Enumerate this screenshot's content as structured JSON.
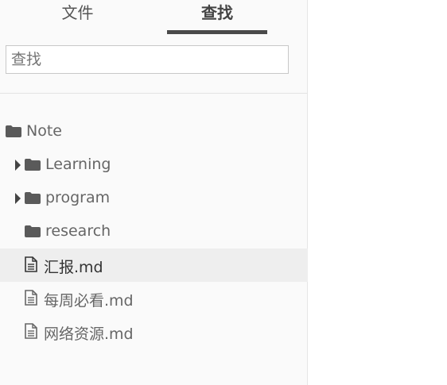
{
  "tabs": {
    "files_label": "文件",
    "search_label": "查找"
  },
  "search": {
    "placeholder": "查找",
    "value": ""
  },
  "tree": {
    "root": "Note",
    "folders": [
      "Learning",
      "program",
      "research"
    ],
    "files": [
      "汇报.md",
      "每周必看.md",
      "网络资源.md"
    ],
    "active_file": "汇报.md"
  },
  "colors": {
    "icon": "#5a5a5a",
    "active_row": "#eeeeee",
    "tab_underline": "#4a4a4a"
  }
}
